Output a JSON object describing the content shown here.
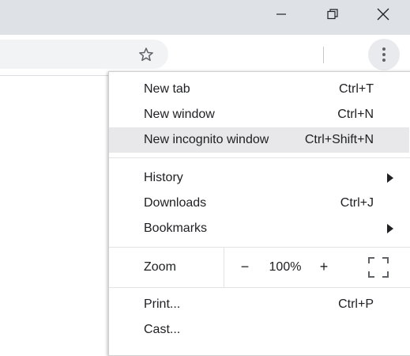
{
  "window_controls": {
    "minimize_icon": "minimize-icon",
    "restore_icon": "restore-icon",
    "close_icon": "close-icon"
  },
  "toolbar": {
    "bookmark_icon": "star-icon",
    "menu_icon": "kebab-menu-icon"
  },
  "menu": {
    "items": [
      {
        "label": "New tab",
        "shortcut": "Ctrl+T"
      },
      {
        "label": "New window",
        "shortcut": "Ctrl+N"
      },
      {
        "label": "New incognito window",
        "shortcut": "Ctrl+Shift+N",
        "highlighted": true
      },
      {
        "label": "History",
        "submenu": true
      },
      {
        "label": "Downloads",
        "shortcut": "Ctrl+J"
      },
      {
        "label": "Bookmarks",
        "submenu": true
      },
      {
        "label": "Print...",
        "shortcut": "Ctrl+P"
      },
      {
        "label": "Cast..."
      }
    ],
    "zoom": {
      "label": "Zoom",
      "minus": "−",
      "value": "100%",
      "plus": "+",
      "fullscreen_icon": "fullscreen-icon"
    }
  },
  "colors": {
    "titlebar_bg": "#dee1e6",
    "highlight_bg": "#e8e8ea",
    "text": "#202124"
  }
}
